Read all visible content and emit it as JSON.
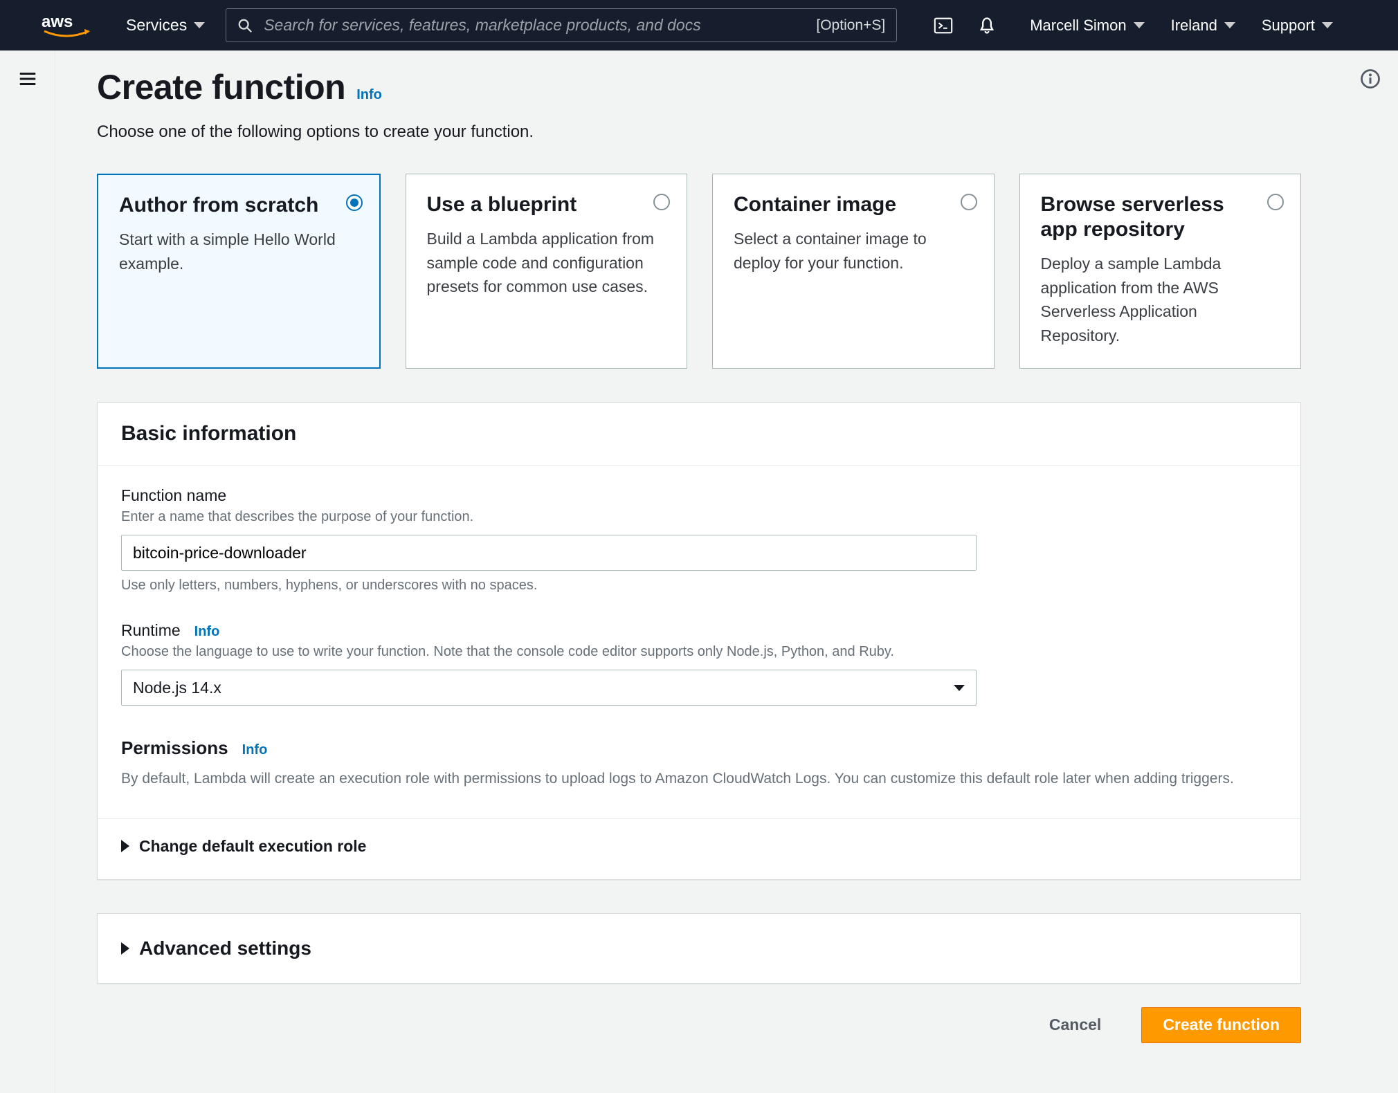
{
  "nav": {
    "services": "Services",
    "search_placeholder": "Search for services, features, marketplace products, and docs",
    "search_hint": "[Option+S]",
    "user": "Marcell Simon",
    "region": "Ireland",
    "support": "Support"
  },
  "page": {
    "title": "Create function",
    "title_info": "Info",
    "subtitle": "Choose one of the following options to create your function."
  },
  "options": [
    {
      "title": "Author from scratch",
      "desc": "Start with a simple Hello World example.",
      "selected": true
    },
    {
      "title": "Use a blueprint",
      "desc": "Build a Lambda application from sample code and configuration presets for common use cases.",
      "selected": false
    },
    {
      "title": "Container image",
      "desc": "Select a container image to deploy for your function.",
      "selected": false
    },
    {
      "title": "Browse serverless app repository",
      "desc": "Deploy a sample Lambda application from the AWS Serverless Application Repository.",
      "selected": false
    }
  ],
  "basic": {
    "panel_title": "Basic information",
    "fn_label": "Function name",
    "fn_desc": "Enter a name that describes the purpose of your function.",
    "fn_value": "bitcoin-price-downloader",
    "fn_hint": "Use only letters, numbers, hyphens, or underscores with no spaces.",
    "rt_label": "Runtime",
    "rt_info": "Info",
    "rt_desc": "Choose the language to use to write your function. Note that the console code editor supports only Node.js, Python, and Ruby.",
    "rt_value": "Node.js 14.x",
    "perm_title": "Permissions",
    "perm_info": "Info",
    "perm_desc": "By default, Lambda will create an execution role with permissions to upload logs to Amazon CloudWatch Logs. You can customize this default role later when adding triggers.",
    "exec_role": "Change default execution role"
  },
  "advanced": {
    "title": "Advanced settings"
  },
  "footer": {
    "cancel": "Cancel",
    "create": "Create function"
  }
}
